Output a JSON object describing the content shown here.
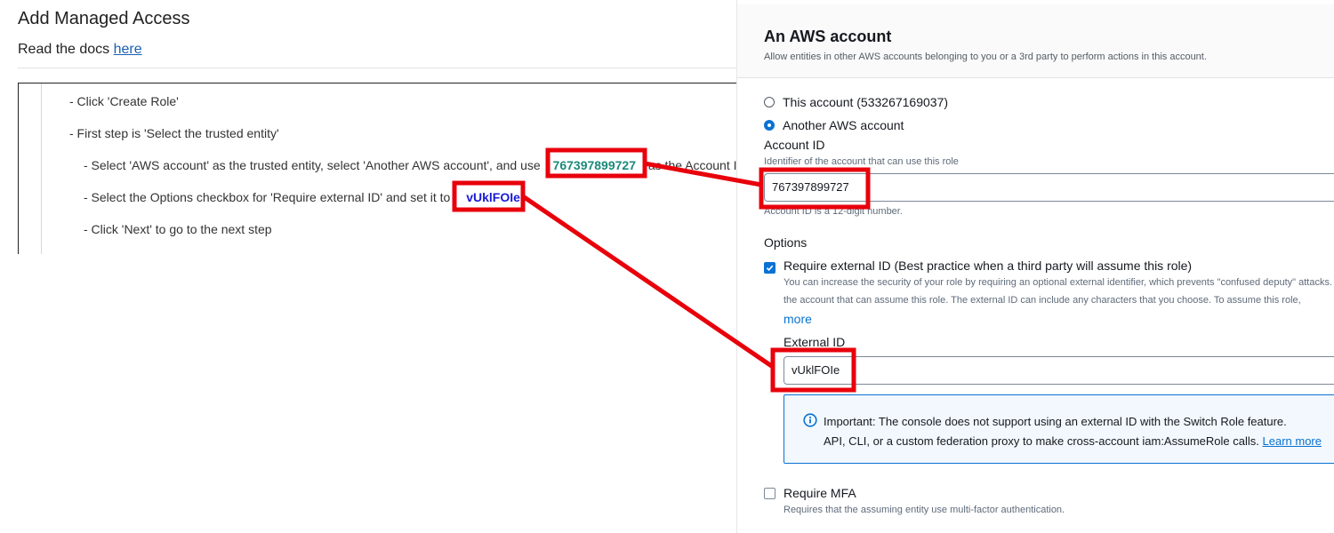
{
  "left": {
    "title": "Add Managed Access",
    "docs_prefix": "Read the docs ",
    "docs_link": "here",
    "steps": [
      "- Click 'Create Role'",
      "- First step is 'Select the trusted entity'",
      "- Select 'AWS account' as the trusted entity, select 'Another AWS account', and use",
      "as the Account ID",
      "- Select the Options checkbox for 'Require external ID' and set it to",
      "- Click 'Next' to go to the next step"
    ],
    "account_id_value": "767397899727",
    "external_id_value": "vUklFOIe"
  },
  "right": {
    "title": "An AWS account",
    "description": "Allow entities in other AWS accounts belonging to you or a 3rd party to perform actions in this account.",
    "radio_this_account": "This account (533267169037)",
    "radio_another_account": "Another AWS account",
    "radio_selected": "another",
    "account_id_label": "Account ID",
    "account_id_hint": "Identifier of the account that can use this role",
    "account_id_value": "767397899727",
    "account_id_constraint": "Account ID is a 12-digit number.",
    "options_label": "Options",
    "require_external_id_label": "Require external ID (Best practice when a third party will assume this role)",
    "require_external_id_checked": true,
    "external_id_desc_line1": "You can increase the security of your role by requiring an optional external identifier, which prevents \"confused deputy\" attacks.",
    "external_id_desc_line2": "the account that can assume this role. The external ID can include any characters that you choose. To assume this role,",
    "more_link": "more",
    "external_id_label": "External ID",
    "external_id_value": "vUklFOIe",
    "important_line1": "Important: The console does not support using an external ID with the Switch Role feature.",
    "important_line2": "API, CLI, or a custom federation proxy to make cross-account iam:AssumeRole calls.",
    "learn_more": "Learn more",
    "require_mfa_label": "Require MFA",
    "require_mfa_checked": false,
    "require_mfa_hint": "Requires that the assuming entity use multi-factor authentication."
  },
  "colors": {
    "annotation_red": "#e8000b",
    "account_id_highlight": "#1b8a7a",
    "external_id_highlight": "#1a1ad6",
    "aws_blue": "#0972d3",
    "link_blue": "#1a5fb4"
  },
  "icons": [
    "info-icon",
    "check-icon"
  ]
}
